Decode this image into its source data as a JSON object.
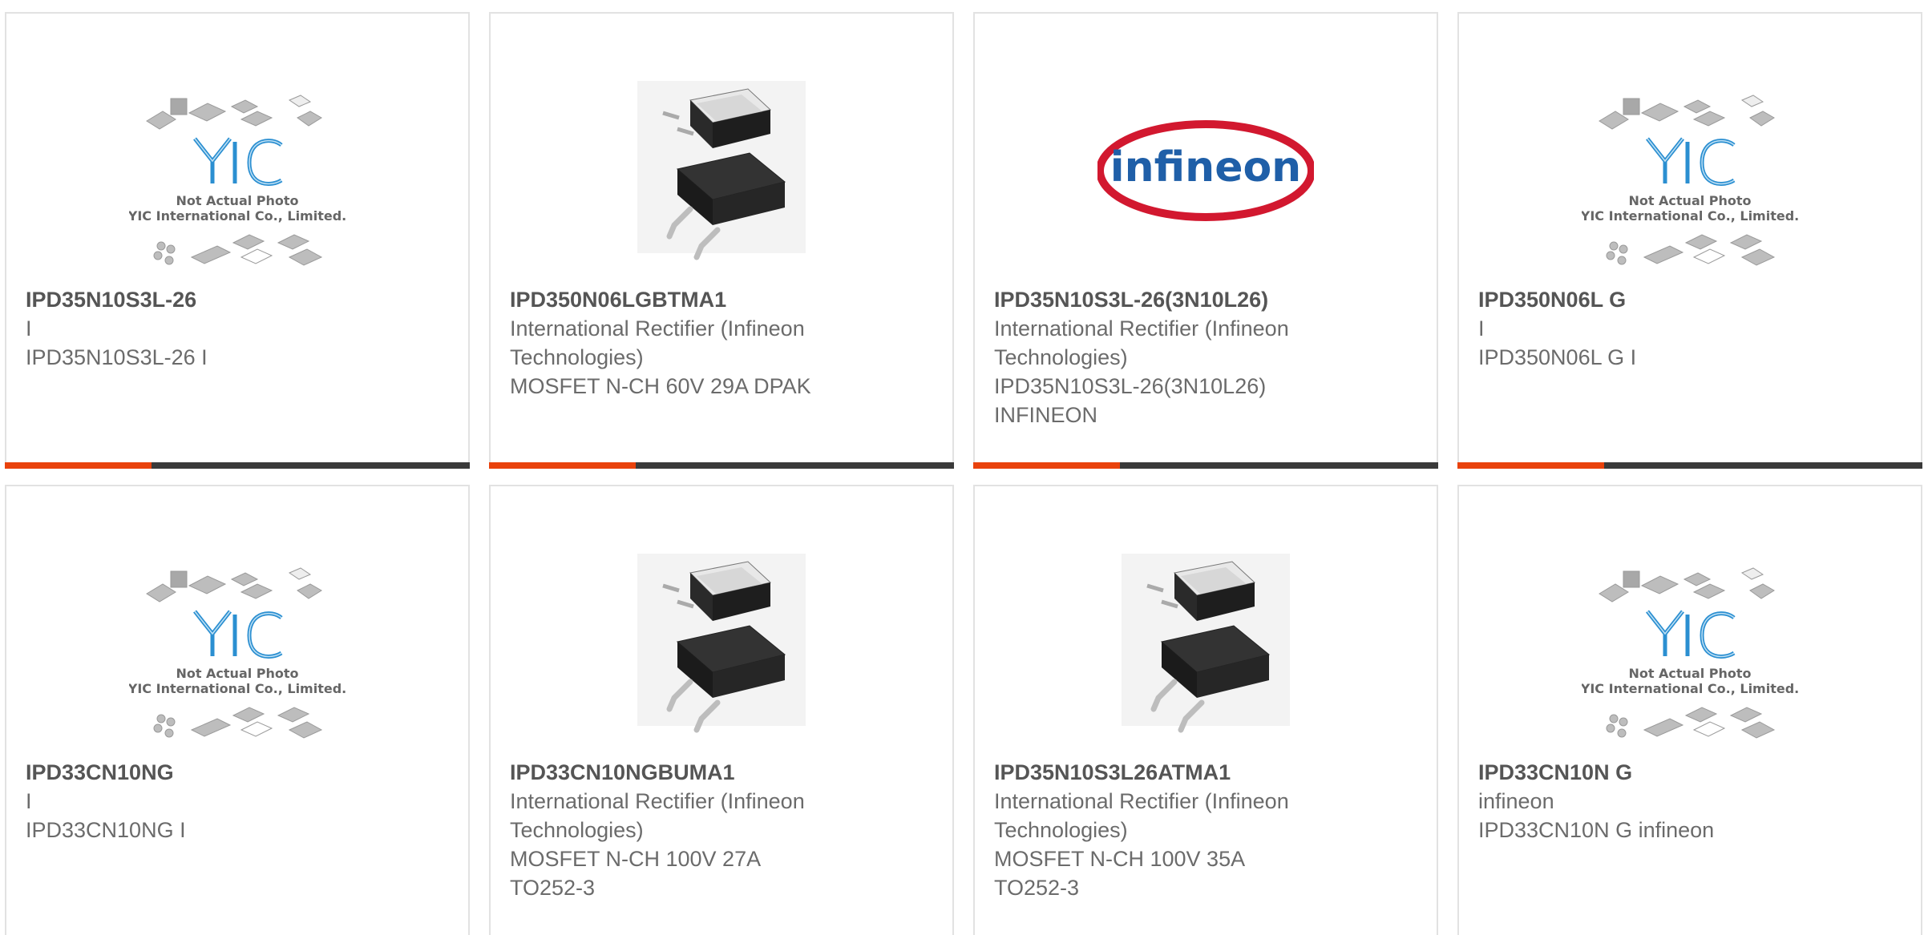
{
  "products": [
    {
      "part_number": "IPD35N10S3L-26",
      "image": "yic-placeholder",
      "lines": [
        "I",
        "IPD35N10S3L-26 I"
      ]
    },
    {
      "part_number": "IPD350N06LGBTMA1",
      "image": "dpak-package",
      "lines": [
        "International Rectifier (Infineon",
        "Technologies)",
        "MOSFET N-CH 60V 29A DPAK"
      ]
    },
    {
      "part_number": "IPD35N10S3L-26(3N10L26)",
      "image": "infineon-logo",
      "lines": [
        "International Rectifier (Infineon",
        "Technologies)",
        "IPD35N10S3L-26(3N10L26)",
        "INFINEON"
      ]
    },
    {
      "part_number": "IPD350N06L G",
      "image": "yic-placeholder",
      "lines": [
        "I",
        "IPD350N06L G I"
      ]
    },
    {
      "part_number": "IPD33CN10NG",
      "image": "yic-placeholder",
      "lines": [
        "I",
        "IPD33CN10NG I"
      ]
    },
    {
      "part_number": "IPD33CN10NGBUMA1",
      "image": "dpak-package",
      "lines": [
        "International Rectifier (Infineon",
        "Technologies)",
        "MOSFET N-CH 100V 27A",
        "TO252-3"
      ]
    },
    {
      "part_number": "IPD35N10S3L26ATMA1",
      "image": "dpak-package",
      "lines": [
        "International Rectifier (Infineon",
        "Technologies)",
        "MOSFET N-CH 100V 35A",
        "TO252-3"
      ]
    },
    {
      "part_number": "IPD33CN10N G",
      "image": "yic-placeholder",
      "lines": [
        "infineon",
        "IPD33CN10N G infineon"
      ]
    }
  ],
  "placeholder": {
    "caption_1": "Not Actual Photo",
    "caption_2": "YIC International Co., Limited."
  },
  "brand_logo_text": "infineon",
  "colors": {
    "accent": "#e9420c",
    "bar": "#3a3a3a",
    "yic_blue": "#2b8fd1",
    "infineon_blue": "#1f5fa8",
    "infineon_red": "#d2182f"
  }
}
